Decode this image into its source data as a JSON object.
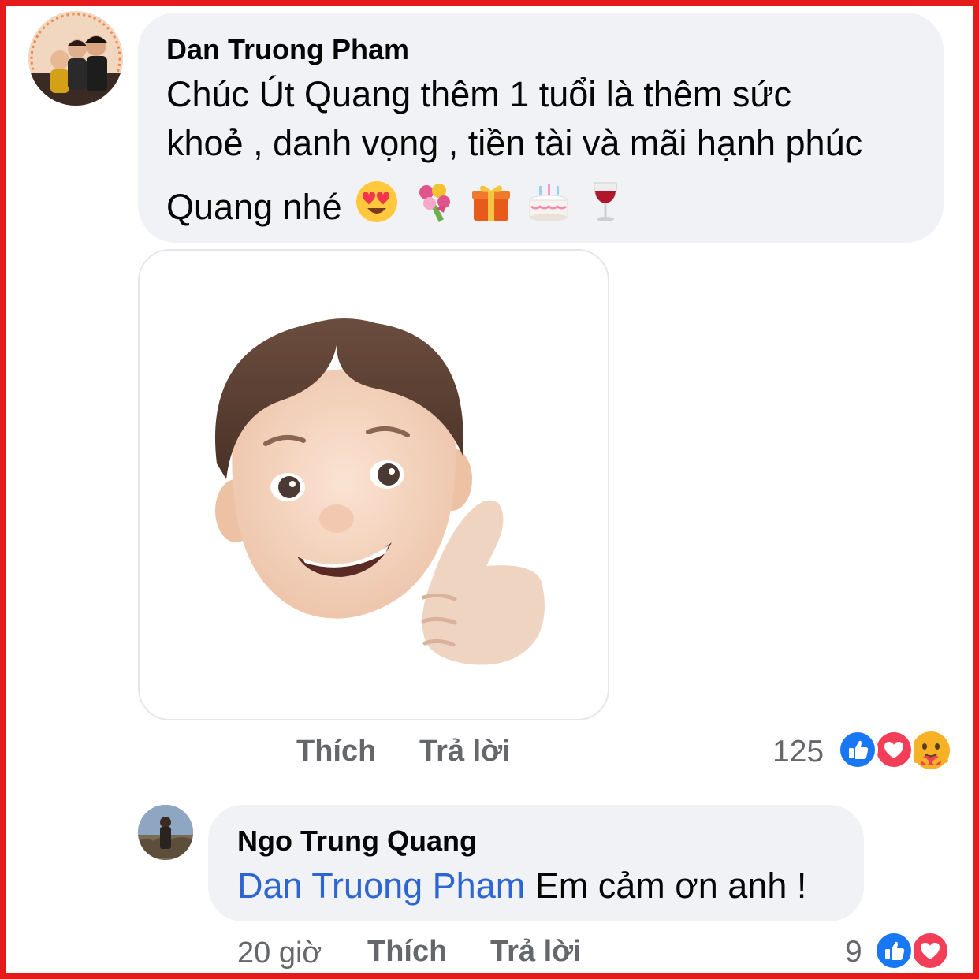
{
  "comment1": {
    "author": "Dan Truong Pham",
    "line1": "Chúc Út Quang thêm 1 tuổi là thêm sức",
    "line2": "khoẻ , danh vọng , tiền tài và mãi hạnh phúc",
    "line3": "Quang nhé",
    "emojis": [
      "heart-eyes",
      "bouquet",
      "gift",
      "birthday-cake",
      "wine-glass"
    ],
    "sticker": "memoji-thumbs-up",
    "actions": {
      "like": "Thích",
      "reply": "Trả lời"
    },
    "reaction_count": "125",
    "reactions": [
      "like",
      "love",
      "care"
    ]
  },
  "comment2": {
    "author": "Ngo Trung Quang",
    "mention": "Dan Truong Pham",
    "text": " Em cảm ơn anh !",
    "time": "20 giờ",
    "actions": {
      "like": "Thích",
      "reply": "Trả lời"
    },
    "reaction_count": "9",
    "reactions": [
      "like",
      "love"
    ]
  },
  "colors": {
    "bubble": "#f0f2f5",
    "mention": "#2d66d3",
    "like": "#1877f2",
    "love": "#f33e58",
    "frame": "#e51b1b"
  }
}
